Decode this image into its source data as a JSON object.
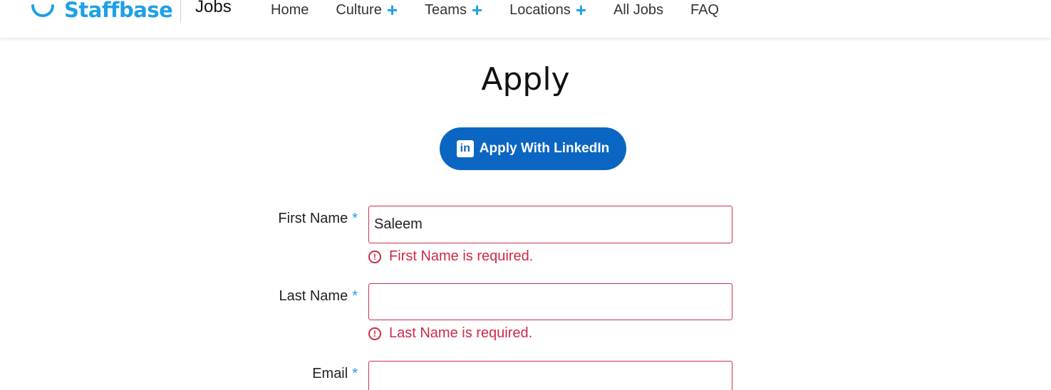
{
  "header": {
    "logo_text": "Staffbase",
    "jobs_label": "Jobs",
    "nav": [
      {
        "label": "Home",
        "has_plus": false
      },
      {
        "label": "Culture",
        "has_plus": true
      },
      {
        "label": "Teams",
        "has_plus": true
      },
      {
        "label": "Locations",
        "has_plus": true
      },
      {
        "label": "All Jobs",
        "has_plus": false
      },
      {
        "label": "FAQ",
        "has_plus": false
      }
    ],
    "plus_glyph": "+"
  },
  "page": {
    "title": "Apply",
    "linkedin_button": "Apply With LinkedIn",
    "linkedin_icon_text": "in"
  },
  "form": {
    "required_marker": "*",
    "fields": [
      {
        "label": "First Name",
        "value": "Saleem",
        "error": "First Name is required."
      },
      {
        "label": "Last Name",
        "value": "",
        "error": "Last Name is required."
      },
      {
        "label": "Email",
        "value": ""
      }
    ],
    "error_icon_glyph": "!"
  },
  "colors": {
    "brand": "#1ea0e6",
    "linkedin": "#0a66c2",
    "error": "#d02a44"
  }
}
